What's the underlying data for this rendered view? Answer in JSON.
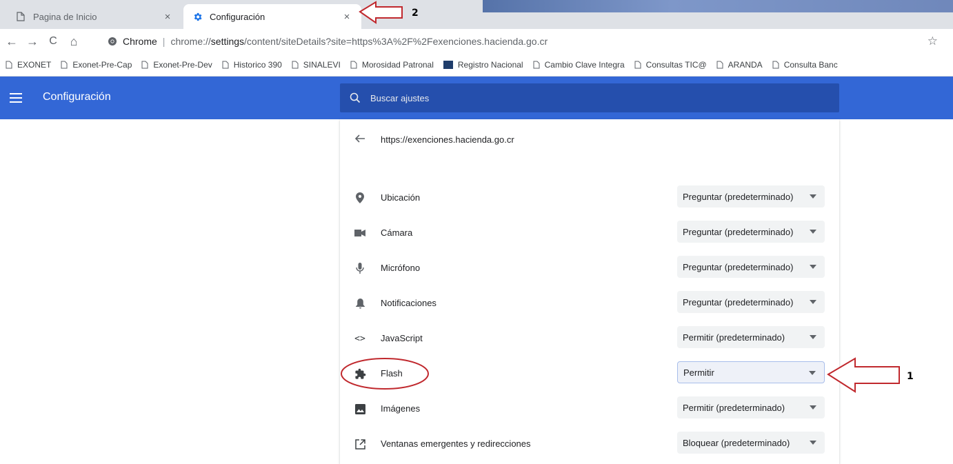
{
  "browser": {
    "tabs": [
      {
        "title": "Pagina de Inicio",
        "close": "×",
        "icon": "page-icon",
        "active": false
      },
      {
        "title": "Configuración",
        "close": "×",
        "icon": "gear-icon",
        "active": true
      }
    ],
    "nav": {
      "back": "←",
      "forward": "→",
      "reload": "C",
      "home": "⌂"
    },
    "omnibox": {
      "scheme_label": "Chrome",
      "separator": "|",
      "url_prefix": "chrome://",
      "url_host": "settings",
      "url_rest": "/content/siteDetails?site=https%3A%2F%2Fexenciones.hacienda.go.cr"
    },
    "star": "☆",
    "bookmarks": [
      "EXONET",
      "Exonet-Pre-Cap",
      "Exonet-Pre-Dev",
      "Historico 390",
      "SINALEVI",
      "Morosidad Patronal",
      "Registro Nacional",
      "Cambio Clave Integra",
      "Consultas TIC@",
      "ARANDA",
      "Consulta Banc"
    ]
  },
  "settings": {
    "title": "Configuración",
    "search_placeholder": "Buscar ajustes",
    "site_url": "https://exenciones.hacienda.go.cr",
    "permissions": [
      {
        "label": "Ubicación",
        "value": "Preguntar (predeterminado)",
        "icon": "location-icon"
      },
      {
        "label": "Cámara",
        "value": "Preguntar (predeterminado)",
        "icon": "camera-icon"
      },
      {
        "label": "Micrófono",
        "value": "Preguntar (predeterminado)",
        "icon": "microphone-icon"
      },
      {
        "label": "Notificaciones",
        "value": "Preguntar (predeterminado)",
        "icon": "bell-icon"
      },
      {
        "label": "JavaScript",
        "value": "Permitir (predeterminado)",
        "icon": "code-icon",
        "icon_text": "<>"
      },
      {
        "label": "Flash",
        "value": "Permitir",
        "icon": "puzzle-icon"
      },
      {
        "label": "Imágenes",
        "value": "Permitir (predeterminado)",
        "icon": "image-icon"
      },
      {
        "label": "Ventanas emergentes y redirecciones",
        "value": "Bloquear (predeterminado)",
        "icon": "open-in-new-icon"
      }
    ]
  },
  "annotations": {
    "arrow_1_label": "1",
    "arrow_2_label": "2",
    "color": "#c0282d"
  }
}
